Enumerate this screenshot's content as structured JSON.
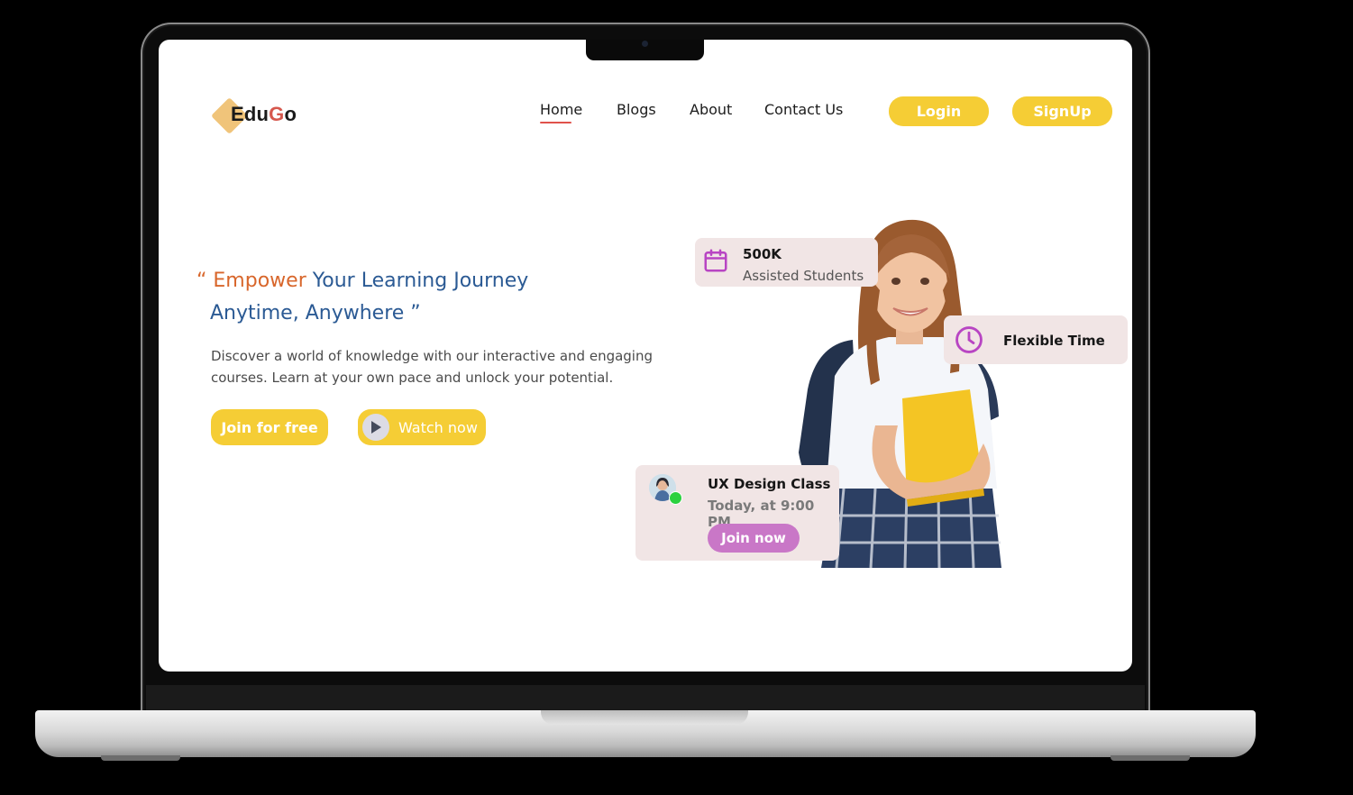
{
  "brand": {
    "name_prefix": "Edu",
    "name_g": "G",
    "name_suffix": "o"
  },
  "nav": {
    "items": [
      "Home",
      "Blogs",
      "About",
      "Contact Us"
    ],
    "active": "Home",
    "login_label": "Login",
    "signup_label": "SignUp"
  },
  "hero": {
    "open_quote": "“",
    "title_highlight": "Empower",
    "title_line1_rest": "Your Learning Journey",
    "title_line2": "Anytime, Anywhere ”",
    "description": "Discover a world of knowledge with our interactive and engaging courses. Learn at your own pace and unlock your potential.",
    "join_label": "Join for free",
    "watch_label": "Watch now"
  },
  "cards": {
    "students": {
      "value": "500K",
      "label": "Assisted Students",
      "icon": "calendar-icon"
    },
    "flexible": {
      "label": "Flexible Time",
      "icon": "clock-icon"
    },
    "class": {
      "title": "UX Design Class",
      "time": "Today, at 9:00 PM",
      "join_label": "Join now"
    }
  },
  "colors": {
    "accent_yellow": "#f5cd35",
    "title_blue": "#2b5a94",
    "highlight_orange": "#d8662b",
    "card_bg": "#f1e5e5",
    "purple": "#c977c7",
    "online_green": "#2bd13f"
  }
}
